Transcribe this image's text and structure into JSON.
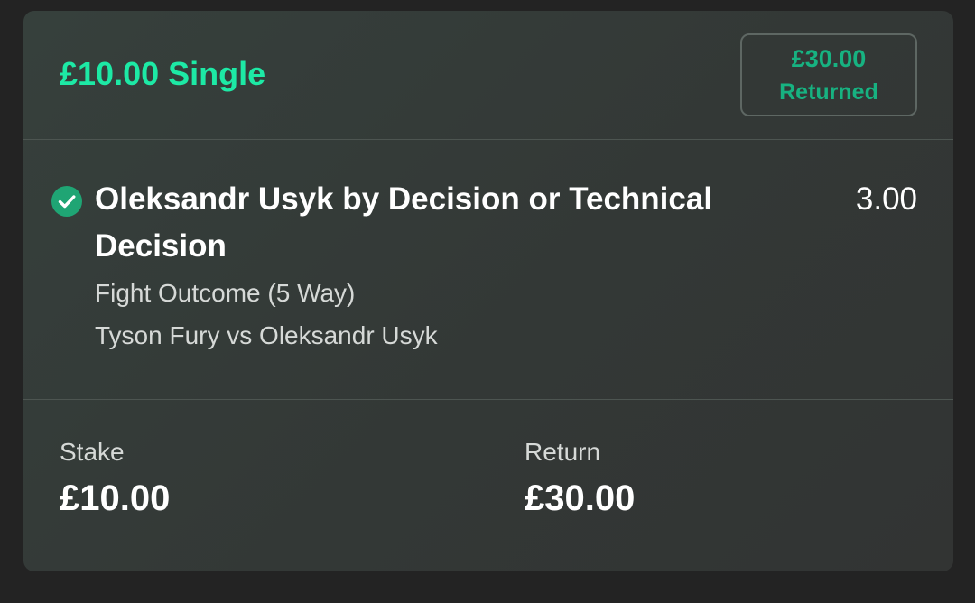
{
  "bet": {
    "title": "£10.00 Single",
    "returned_amount": "£30.00",
    "returned_label": "Returned",
    "status_icon": "check-circle-icon",
    "accent_color": "#1de9a5",
    "status_color": "#17b281"
  },
  "selection": {
    "name": "Oleksandr Usyk by Decision or Technical Decision",
    "odds": "3.00",
    "market": "Fight Outcome (5 Way)",
    "event": "Tyson Fury vs Oleksandr Usyk"
  },
  "summary": {
    "stake_label": "Stake",
    "stake_value": "£10.00",
    "return_label": "Return",
    "return_value": "£30.00"
  }
}
